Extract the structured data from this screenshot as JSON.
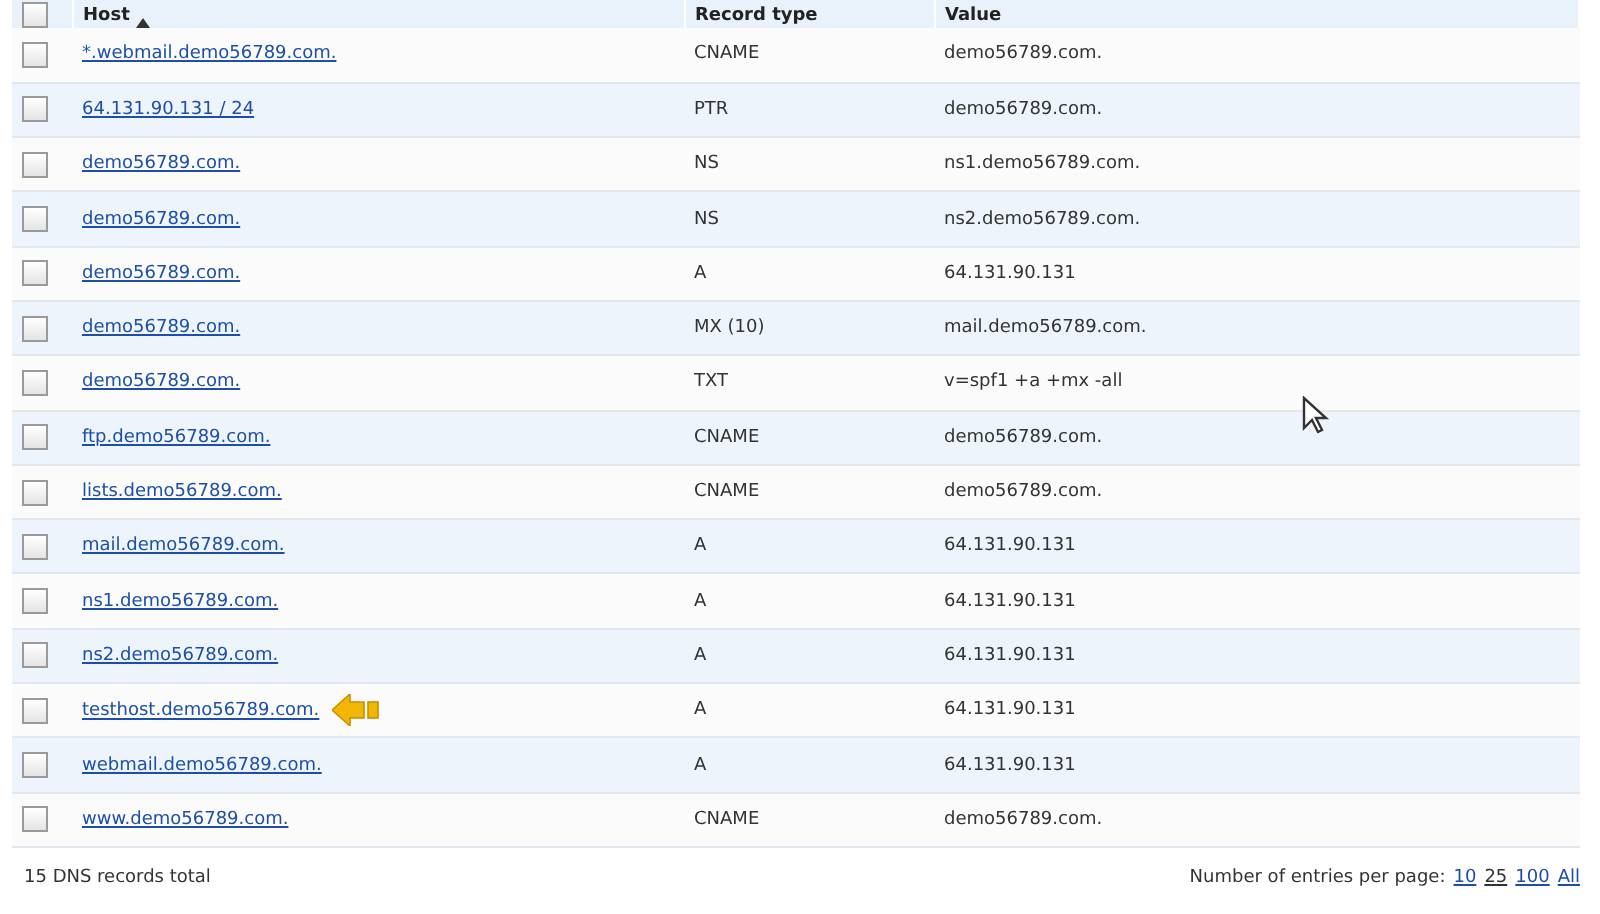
{
  "table": {
    "columns": [
      {
        "label": "Host",
        "sorted": true
      },
      {
        "label": "Record type",
        "sorted": false
      },
      {
        "label": "Value",
        "sorted": false
      }
    ],
    "header_checked": false,
    "rows": [
      {
        "host": "*.webmail.demo56789.com.",
        "type": "CNAME",
        "value": "demo56789.com.",
        "checked": false,
        "pointer": false
      },
      {
        "host": "64.131.90.131 / 24",
        "type": "PTR",
        "value": "demo56789.com.",
        "checked": false,
        "pointer": false
      },
      {
        "host": "demo56789.com.",
        "type": "NS",
        "value": "ns1.demo56789.com.",
        "checked": false,
        "pointer": false
      },
      {
        "host": "demo56789.com.",
        "type": "NS",
        "value": "ns2.demo56789.com.",
        "checked": false,
        "pointer": false
      },
      {
        "host": "demo56789.com.",
        "type": "A",
        "value": "64.131.90.131",
        "checked": false,
        "pointer": false
      },
      {
        "host": "demo56789.com.",
        "type": "MX (10)",
        "value": "mail.demo56789.com.",
        "checked": false,
        "pointer": false
      },
      {
        "host": "demo56789.com.",
        "type": "TXT",
        "value": "v=spf1 +a +mx -all",
        "checked": false,
        "pointer": false
      },
      {
        "host": "ftp.demo56789.com.",
        "type": "CNAME",
        "value": "demo56789.com.",
        "checked": false,
        "pointer": false
      },
      {
        "host": "lists.demo56789.com.",
        "type": "CNAME",
        "value": "demo56789.com.",
        "checked": false,
        "pointer": false
      },
      {
        "host": "mail.demo56789.com.",
        "type": "A",
        "value": "64.131.90.131",
        "checked": false,
        "pointer": false
      },
      {
        "host": "ns1.demo56789.com.",
        "type": "A",
        "value": "64.131.90.131",
        "checked": false,
        "pointer": false
      },
      {
        "host": "ns2.demo56789.com.",
        "type": "A",
        "value": "64.131.90.131",
        "checked": false,
        "pointer": false
      },
      {
        "host": "testhost.demo56789.com.",
        "type": "A",
        "value": "64.131.90.131",
        "checked": false,
        "pointer": true
      },
      {
        "host": "webmail.demo56789.com.",
        "type": "A",
        "value": "64.131.90.131",
        "checked": false,
        "pointer": false
      },
      {
        "host": "www.demo56789.com.",
        "type": "CNAME",
        "value": "demo56789.com.",
        "checked": false,
        "pointer": false
      }
    ]
  },
  "footer": {
    "total": "15 DNS records total",
    "per_page_label": "Number of entries per page:",
    "per_page_options": [
      {
        "label": "10",
        "selected": false
      },
      {
        "label": "25",
        "selected": true
      },
      {
        "label": "100",
        "selected": false
      },
      {
        "label": "All",
        "selected": false
      }
    ]
  }
}
